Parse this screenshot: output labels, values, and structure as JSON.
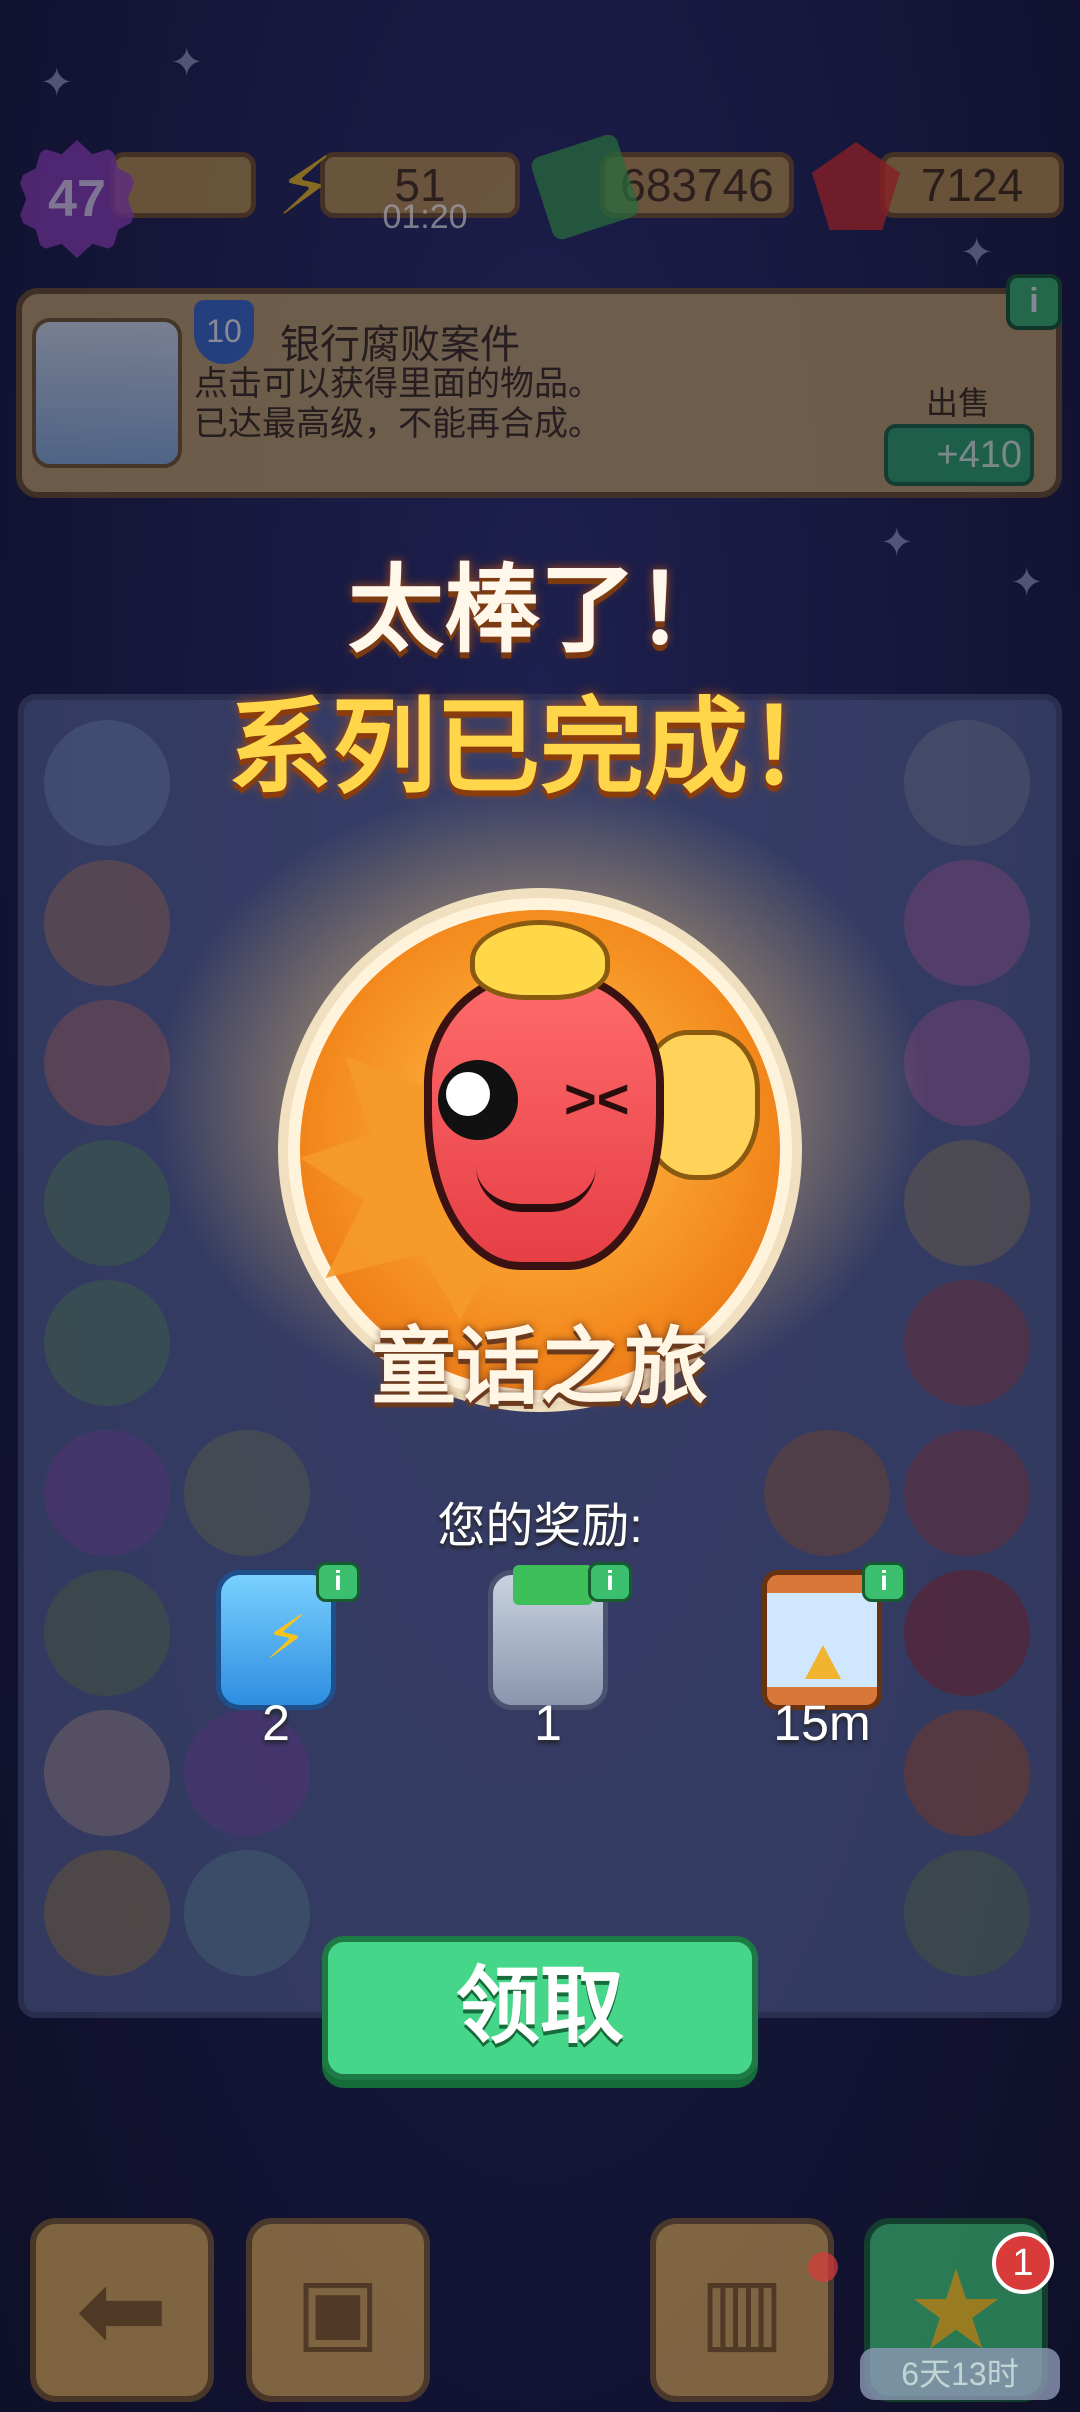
{
  "top_bar": {
    "level": "47",
    "energy": "51",
    "energy_timer": "01:20",
    "cash": "683746",
    "gems": "7124"
  },
  "info_panel": {
    "item_level": "10",
    "item_name": "银行腐败案件",
    "description_line1": "点击可以获得里面的物品。",
    "description_line2": "已达最高级，不能再合成。",
    "sell_label": "出售",
    "sell_value": "+410",
    "info_icon": "i"
  },
  "popup": {
    "title_line1": "太棒了！",
    "title_line2": "系列已完成！",
    "collection_name": "童话之旅",
    "rewards_label": "您的奖励:",
    "rewards": [
      {
        "icon": "energy-bottle-icon",
        "count": "2"
      },
      {
        "icon": "cash-safe-icon",
        "count": "1"
      },
      {
        "icon": "hourglass-icon",
        "count": "15m"
      }
    ],
    "claim_label": "领取"
  },
  "bottom_nav": {
    "notification_count": "1",
    "event_timer": "6天13时"
  },
  "colors": {
    "accent_green": "#46d68a",
    "title_yellow": "#ffd64a",
    "panel_tan": "#c79b4c"
  }
}
